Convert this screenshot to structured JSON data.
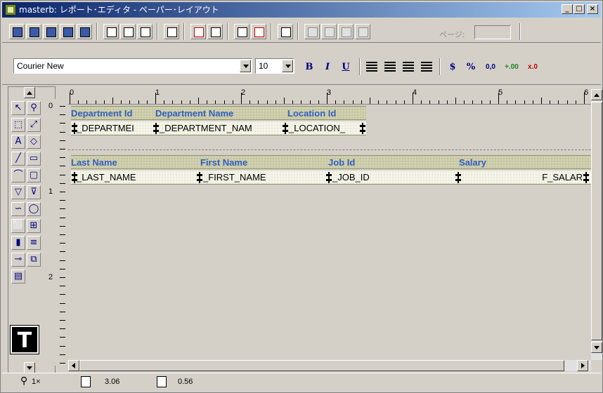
{
  "window": {
    "title": "masterb: レポート･エディタ - ペーパー･レイアウト",
    "minimize": "_",
    "maximize": "□",
    "close": "×"
  },
  "toolbar": {
    "page_label": "ページ:",
    "page_value": ""
  },
  "format_bar": {
    "font_name": "Courier New",
    "font_size": "10",
    "bold": "B",
    "italic": "I",
    "underline": "U",
    "currency": "$",
    "percent": "%",
    "comma": "0,0",
    "add_decimal": "+.00",
    "remove_decimal": "x.0"
  },
  "rulers": {
    "horizontal": [
      "0",
      "1",
      "2",
      "3",
      "4",
      "5",
      "6"
    ],
    "vertical": [
      "0",
      "1",
      "2"
    ]
  },
  "layout": {
    "master_labels": [
      "Department Id",
      "Department Name",
      "Location Id"
    ],
    "master_fields": [
      "_DEPARTMEI",
      "_DEPARTMENT_NAM",
      "_LOCATION_"
    ],
    "detail_labels": [
      "Last Name",
      "First Name",
      "Job Id",
      "Salary"
    ],
    "detail_fields": [
      "_LAST_NAME",
      "_FIRST_NAME",
      "_JOB_ID",
      "F_SALAR"
    ]
  },
  "status_bar": {
    "zoom": "1×",
    "x_pos": "3.06",
    "y_pos": "0.56"
  }
}
